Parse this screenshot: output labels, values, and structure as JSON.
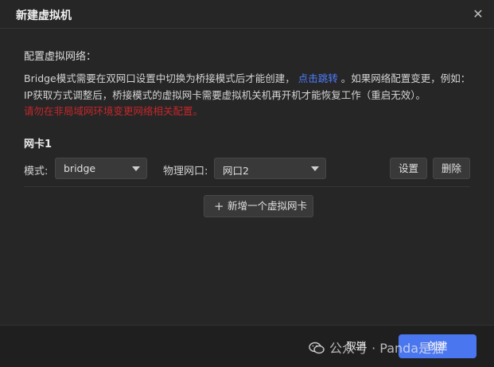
{
  "dialog": {
    "title": "新建虚拟机",
    "close_icon": "close-icon"
  },
  "network": {
    "section_title": "配置虚拟网络：",
    "description_part1": "Bridge模式需要在双网口设置中切换为桥接模式后才能创建，",
    "link_text": "点击跳转",
    "description_part2": "。如果网络配置变更，例如：IP获取方式调整后，桥接模式的虚拟网卡需要虚拟机关机再开机才能恢复工作（重启无效）。",
    "warning": "请勿在非局域网环境变更网络相关配置。",
    "colors": {
      "link": "#4f7dff",
      "warning": "#c4272b",
      "primary": "#4a76f0"
    }
  },
  "nic": {
    "title": "网卡1",
    "mode_label": "模式:",
    "mode_value": "bridge",
    "port_label": "物理网口:",
    "port_value": "网口2",
    "settings_label": "设置",
    "delete_label": "删除",
    "add_label": "新增一个虚拟网卡"
  },
  "footer": {
    "cancel_label": "取消",
    "create_label": "创建"
  },
  "watermark": {
    "text": "公众号 · Panda是猫",
    "icon": "wechat-icon"
  }
}
